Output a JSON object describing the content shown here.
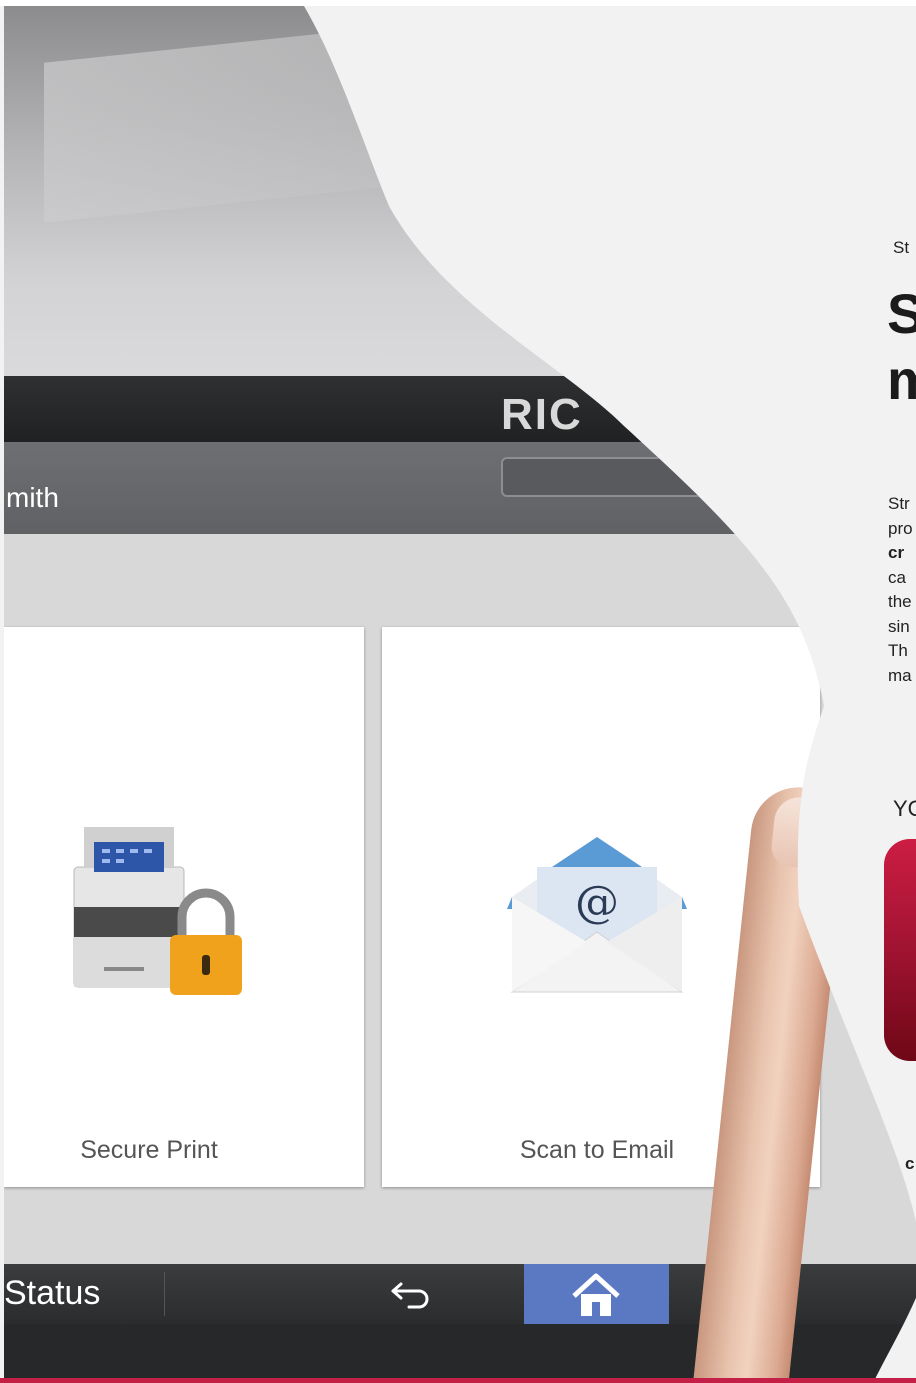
{
  "right_column": {
    "eyebrow": "St",
    "headline_line1": "S",
    "headline_line2": "m",
    "body_lines": [
      "Str",
      "pro",
      "cr",
      "ca",
      "the",
      "sin",
      "Th",
      "ma"
    ],
    "you_label": "YO",
    "bottom_letter": "c"
  },
  "device_screen": {
    "brand": "RIC",
    "user_name": "mith",
    "tiles": [
      {
        "label": "Secure Print",
        "icon": "printer-lock-icon"
      },
      {
        "label": "Scan to Email",
        "icon": "email-envelope-icon"
      }
    ],
    "nav": {
      "status_label": "Status",
      "back_icon": "back-arrow-icon",
      "home_icon": "home-icon"
    }
  },
  "colors": {
    "accent_red": "#c41f47",
    "home_blue": "#5b78c2",
    "page_bg": "#f2f2f2"
  }
}
